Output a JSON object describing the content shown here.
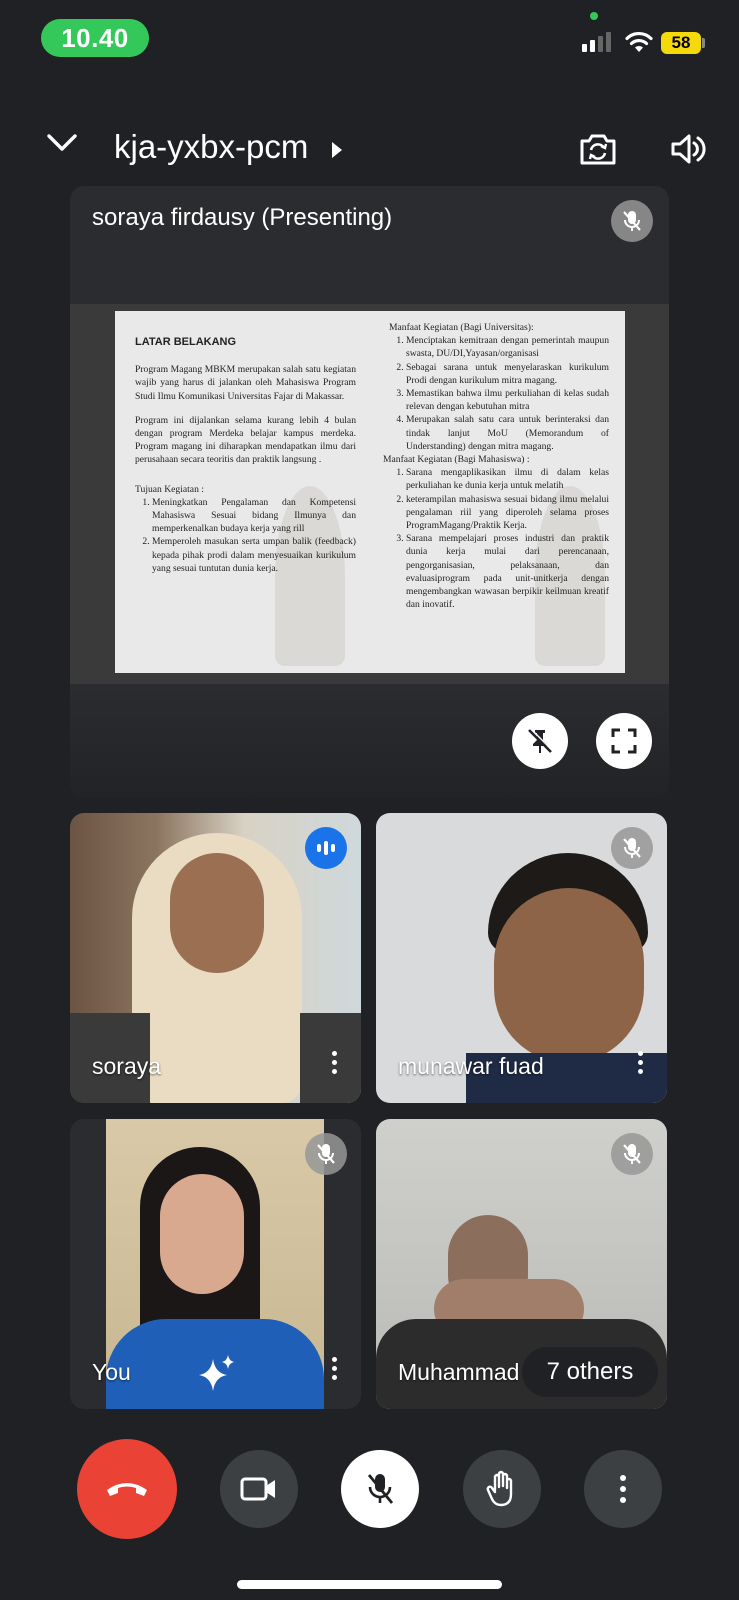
{
  "status_bar": {
    "time": "10.40",
    "battery": "58"
  },
  "header": {
    "meeting_code": "kja-yxbx-pcm"
  },
  "presentation": {
    "presenter_label": "soraya firdausy (Presenting)",
    "slide": {
      "left_title": "LATAR BELAKANG",
      "left_p1": "Program Magang MBKM merupakan salah satu kegiatan wajib yang harus di jalankan oleh Mahasiswa Program Studi Ilmu Komunikasi Universitas Fajar di Makassar.",
      "left_p2": "Program ini dijalankan selama kurang lebih 4 bulan dengan program Merdeka belajar kampus merdeka. Program magang ini diharapkan mendapatkan ilmu dari perusahaan secara teoritis dan praktik langsung .",
      "tujuan_title": "Tujuan Kegiatan :",
      "tujuan_items": [
        "Meningkatkan Pengalaman dan Kompetensi Mahasiswa Sesuai bidang Ilmunya dan memperkenalkan budaya kerja yang rill",
        "Memperoleh masukan serta umpan balik (feedback) kepada pihak prodi dalam menyesuaikan kurikulum yang sesuai tuntutan dunia kerja."
      ],
      "univ_title": "Manfaat Kegiatan (Bagi Universitas):",
      "univ_items": [
        "Menciptakan kemitraan dengan pemerintah maupun swasta, DU/DI,Yayasan/organisasi",
        "Sebagai sarana untuk menyelaraskan kurikulum Prodi dengan kurikulum mitra magang.",
        "Memastikan bahwa ilmu perkuliahan di kelas sudah relevan dengan kebutuhan mitra",
        "Merupakan salah satu cara untuk berinteraksi dan tindak lanjut MoU (Memorandum of Understanding) dengan mitra magang."
      ],
      "mhs_title": "Manfaat Kegiatan (Bagi Mahasiswa) :",
      "mhs_items": [
        "Sarana mengaplikasikan ilmu di dalam kelas perkuliahan ke dunia kerja untuk melatih",
        "keterampilan mahasiswa sesuai bidang ilmu melalui pengalaman riil yang diperoleh selama proses ProgramMagang/Praktik Kerja.",
        "Sarana mempelajari proses industri dan praktik dunia kerja mulai dari perencanaan, pengorganisasian, pelaksanaan, dan evaluasiprogram pada unit-unitkerja dengan mengembangkan wawasan berpikir keilmuan kreatif dan inovatif."
      ]
    }
  },
  "participants": [
    {
      "name": "soraya",
      "state": "speaking"
    },
    {
      "name": "munawar fuad",
      "state": "muted"
    },
    {
      "name": "You",
      "state": "muted"
    },
    {
      "name": "Muhammad",
      "state": "muted"
    }
  ],
  "others_label": "7 others",
  "icons": [
    "chevron-down-icon",
    "play-arrow-icon",
    "switch-camera-icon",
    "speaker-icon",
    "mic-off-icon",
    "unpin-icon",
    "fullscreen-icon",
    "more-vert-icon",
    "sparkle-icon",
    "end-call-icon",
    "camera-icon",
    "raise-hand-icon"
  ],
  "colors": {
    "end_call": "#ea4335",
    "speaking": "#1a73e8",
    "time_pill": "#34c759",
    "battery": "#f5d90a"
  }
}
